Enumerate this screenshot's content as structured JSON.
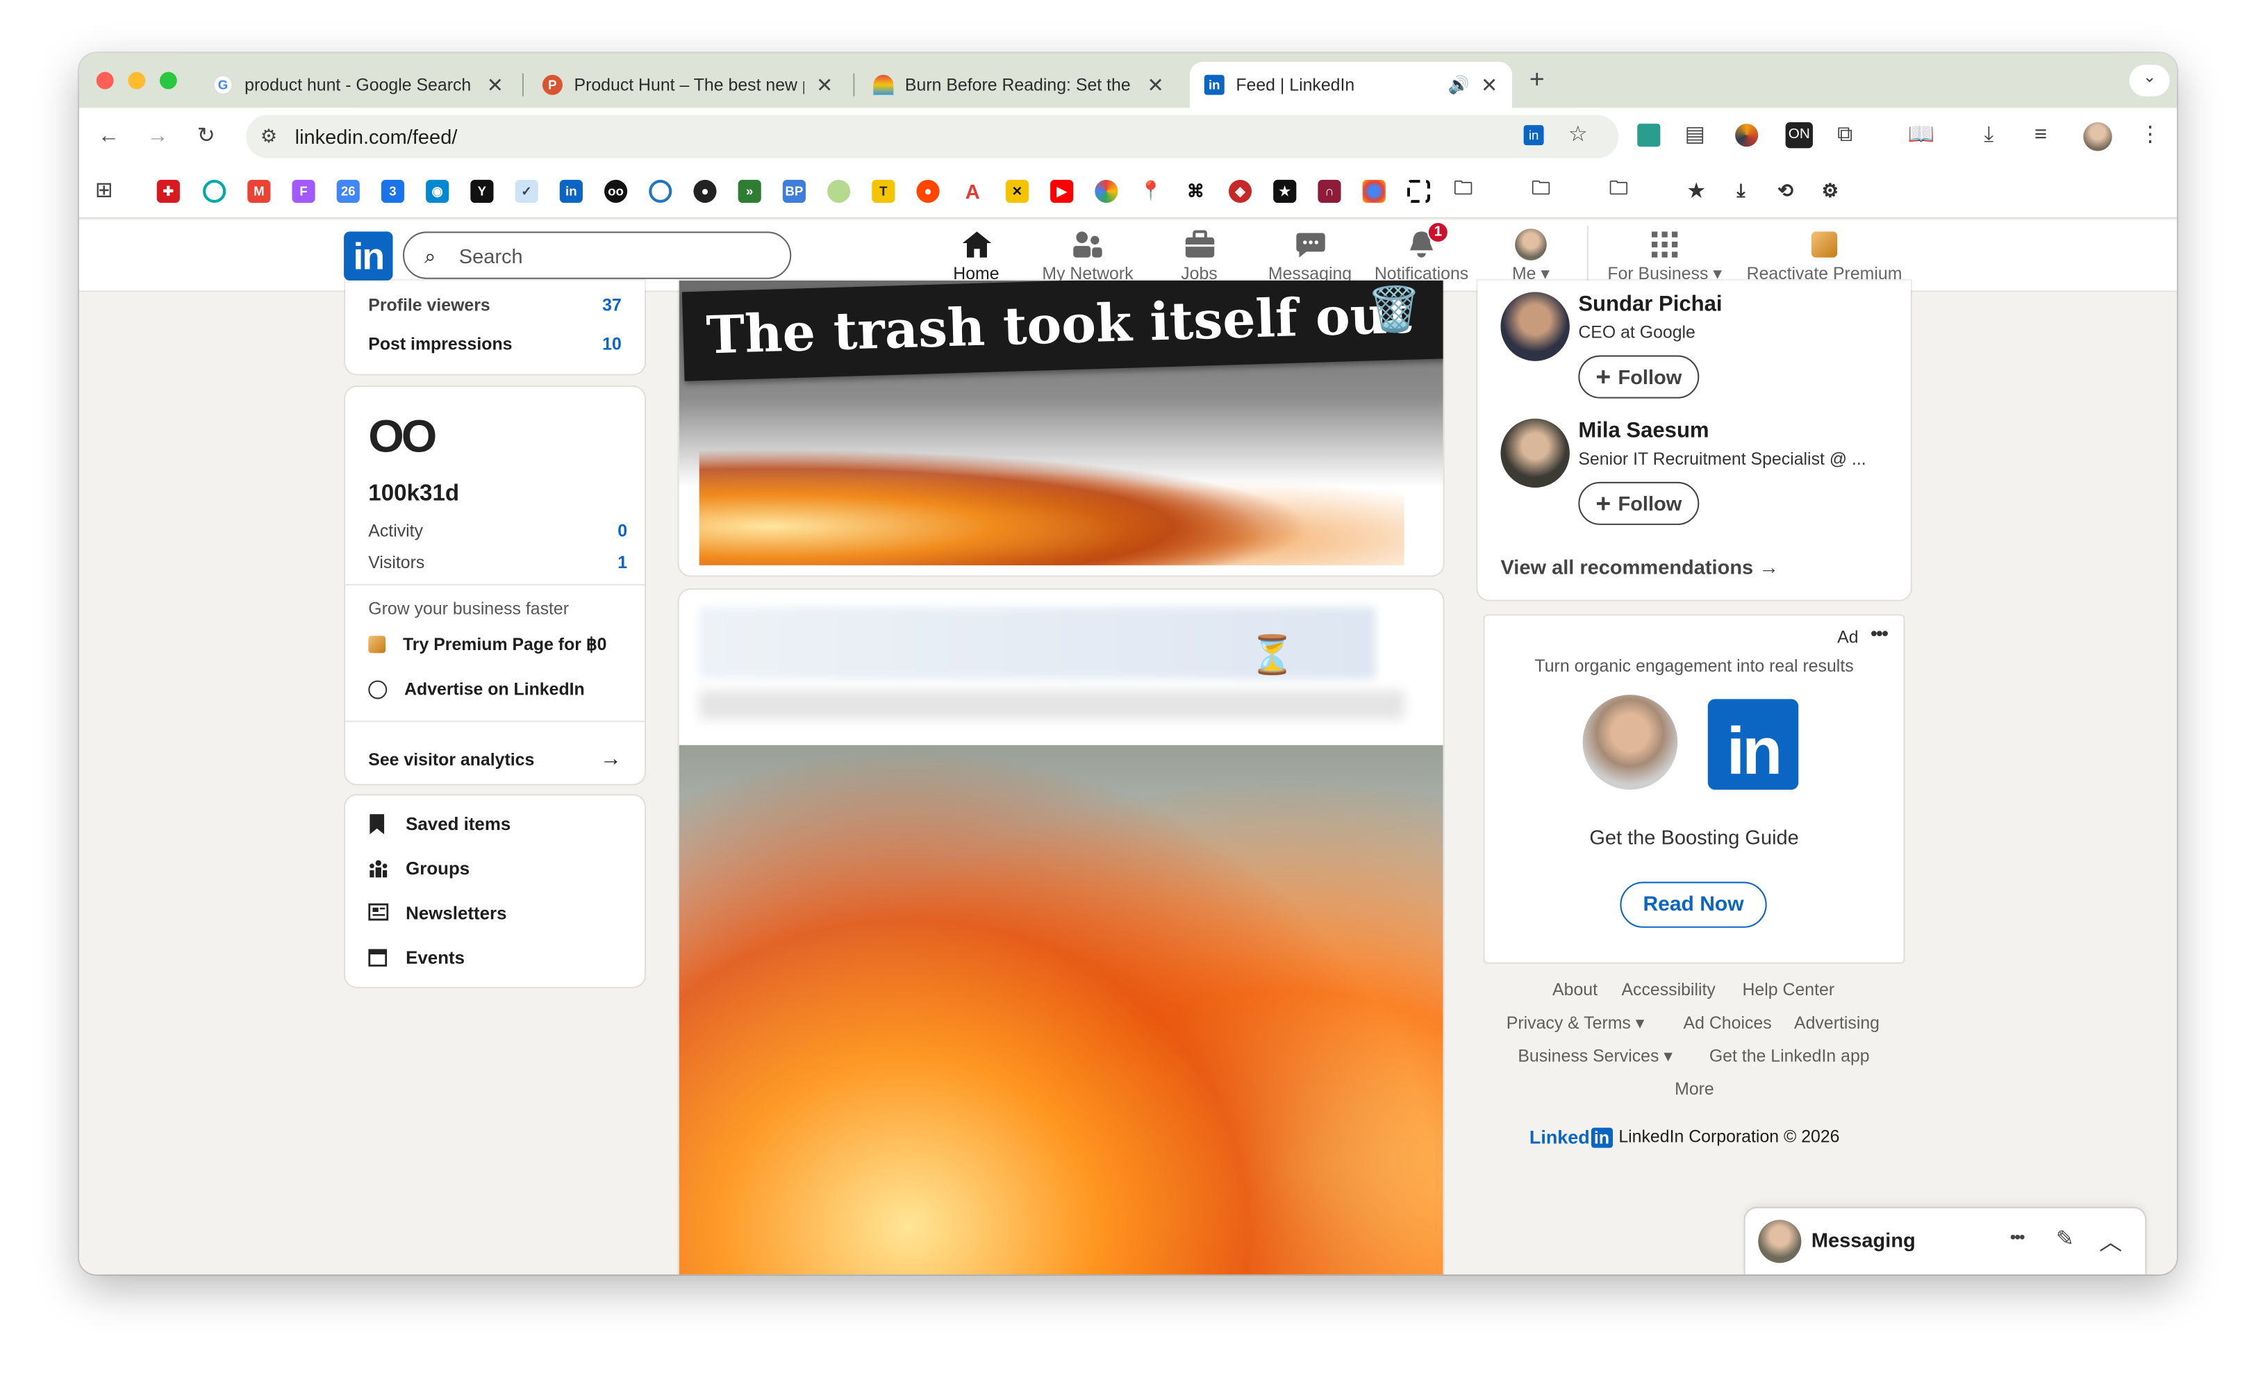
{
  "browser": {
    "tabs": [
      {
        "title": "product hunt - Google Search",
        "favicon": "google-icon",
        "active": false
      },
      {
        "title": "Product Hunt – The best new products in tech",
        "favicon": "product-hunt-icon",
        "active": false
      },
      {
        "title": "Burn Before Reading: Set the",
        "favicon": "rainbow-icon",
        "active": false
      },
      {
        "title": "Feed | LinkedIn",
        "favicon": "linkedin-icon",
        "active": true
      }
    ],
    "new_tab": "+",
    "url": "linkedin.com/feed/"
  },
  "linkedin": {
    "logo": "in",
    "search_placeholder": "Search",
    "nav": [
      {
        "label": "Home",
        "icon": "home-icon",
        "active": true
      },
      {
        "label": "My Network",
        "icon": "network-icon"
      },
      {
        "label": "Jobs",
        "icon": "briefcase-icon"
      },
      {
        "label": "Messaging",
        "icon": "messaging-icon"
      },
      {
        "label": "Notifications",
        "icon": "bell-icon",
        "badge": "1"
      },
      {
        "label": "Me",
        "icon": "avatar"
      },
      {
        "label": "For Business",
        "icon": "grid-icon"
      },
      {
        "label": "Reactivate Premium",
        "icon": "premium-icon"
      }
    ]
  },
  "left": {
    "profile_viewers_label": "Profile viewers",
    "profile_viewers_value": "37",
    "post_impressions_label": "Post impressions",
    "post_impressions_value": "10",
    "page_logo_text": "OO",
    "page_name": "100k31d",
    "activity_label": "Activity",
    "activity_value": "0",
    "visitors_label": "Visitors",
    "visitors_value": "1",
    "grow_text": "Grow your business faster",
    "premium_page": "Try Premium Page for ฿0",
    "advertise": "Advertise on LinkedIn",
    "visitor_analytics": "See visitor analytics",
    "menu": [
      {
        "label": "Saved items",
        "icon": "bookmark-icon"
      },
      {
        "label": "Groups",
        "icon": "groups-icon"
      },
      {
        "label": "Newsletters",
        "icon": "newsletter-icon"
      },
      {
        "label": "Events",
        "icon": "calendar-icon"
      }
    ]
  },
  "feed": {
    "banner_text": "The trash took itself out",
    "banner_emoji": "🗑️",
    "hourglass": "⏳"
  },
  "right": {
    "recommendations": [
      {
        "name": "Sundar Pichai",
        "title": "CEO at Google",
        "follow": "Follow"
      },
      {
        "name": "Mila Saesum",
        "title": "Senior IT Recruitment Specialist @ ...",
        "follow": "Follow"
      }
    ],
    "view_all": "View all recommendations",
    "ad": {
      "label": "Ad",
      "headline": "Turn organic engagement into real results",
      "cta_text": "Get the Boosting Guide",
      "button": "Read Now"
    },
    "footer": {
      "about": "About",
      "accessibility": "Accessibility",
      "help": "Help Center",
      "privacy": "Privacy & Terms",
      "ad_choices": "Ad Choices",
      "advertising": "Advertising",
      "business": "Business Services",
      "app": "Get the LinkedIn app",
      "more": "More",
      "brand_word": "Linked",
      "brand_in": "in",
      "copyright": "LinkedIn Corporation © 2026"
    }
  },
  "messaging": {
    "label": "Messaging"
  },
  "colors": {
    "linkedin_blue": "#0a66c2",
    "tab_strip": "#dde3d6",
    "page_bg": "#f4f2ee"
  }
}
